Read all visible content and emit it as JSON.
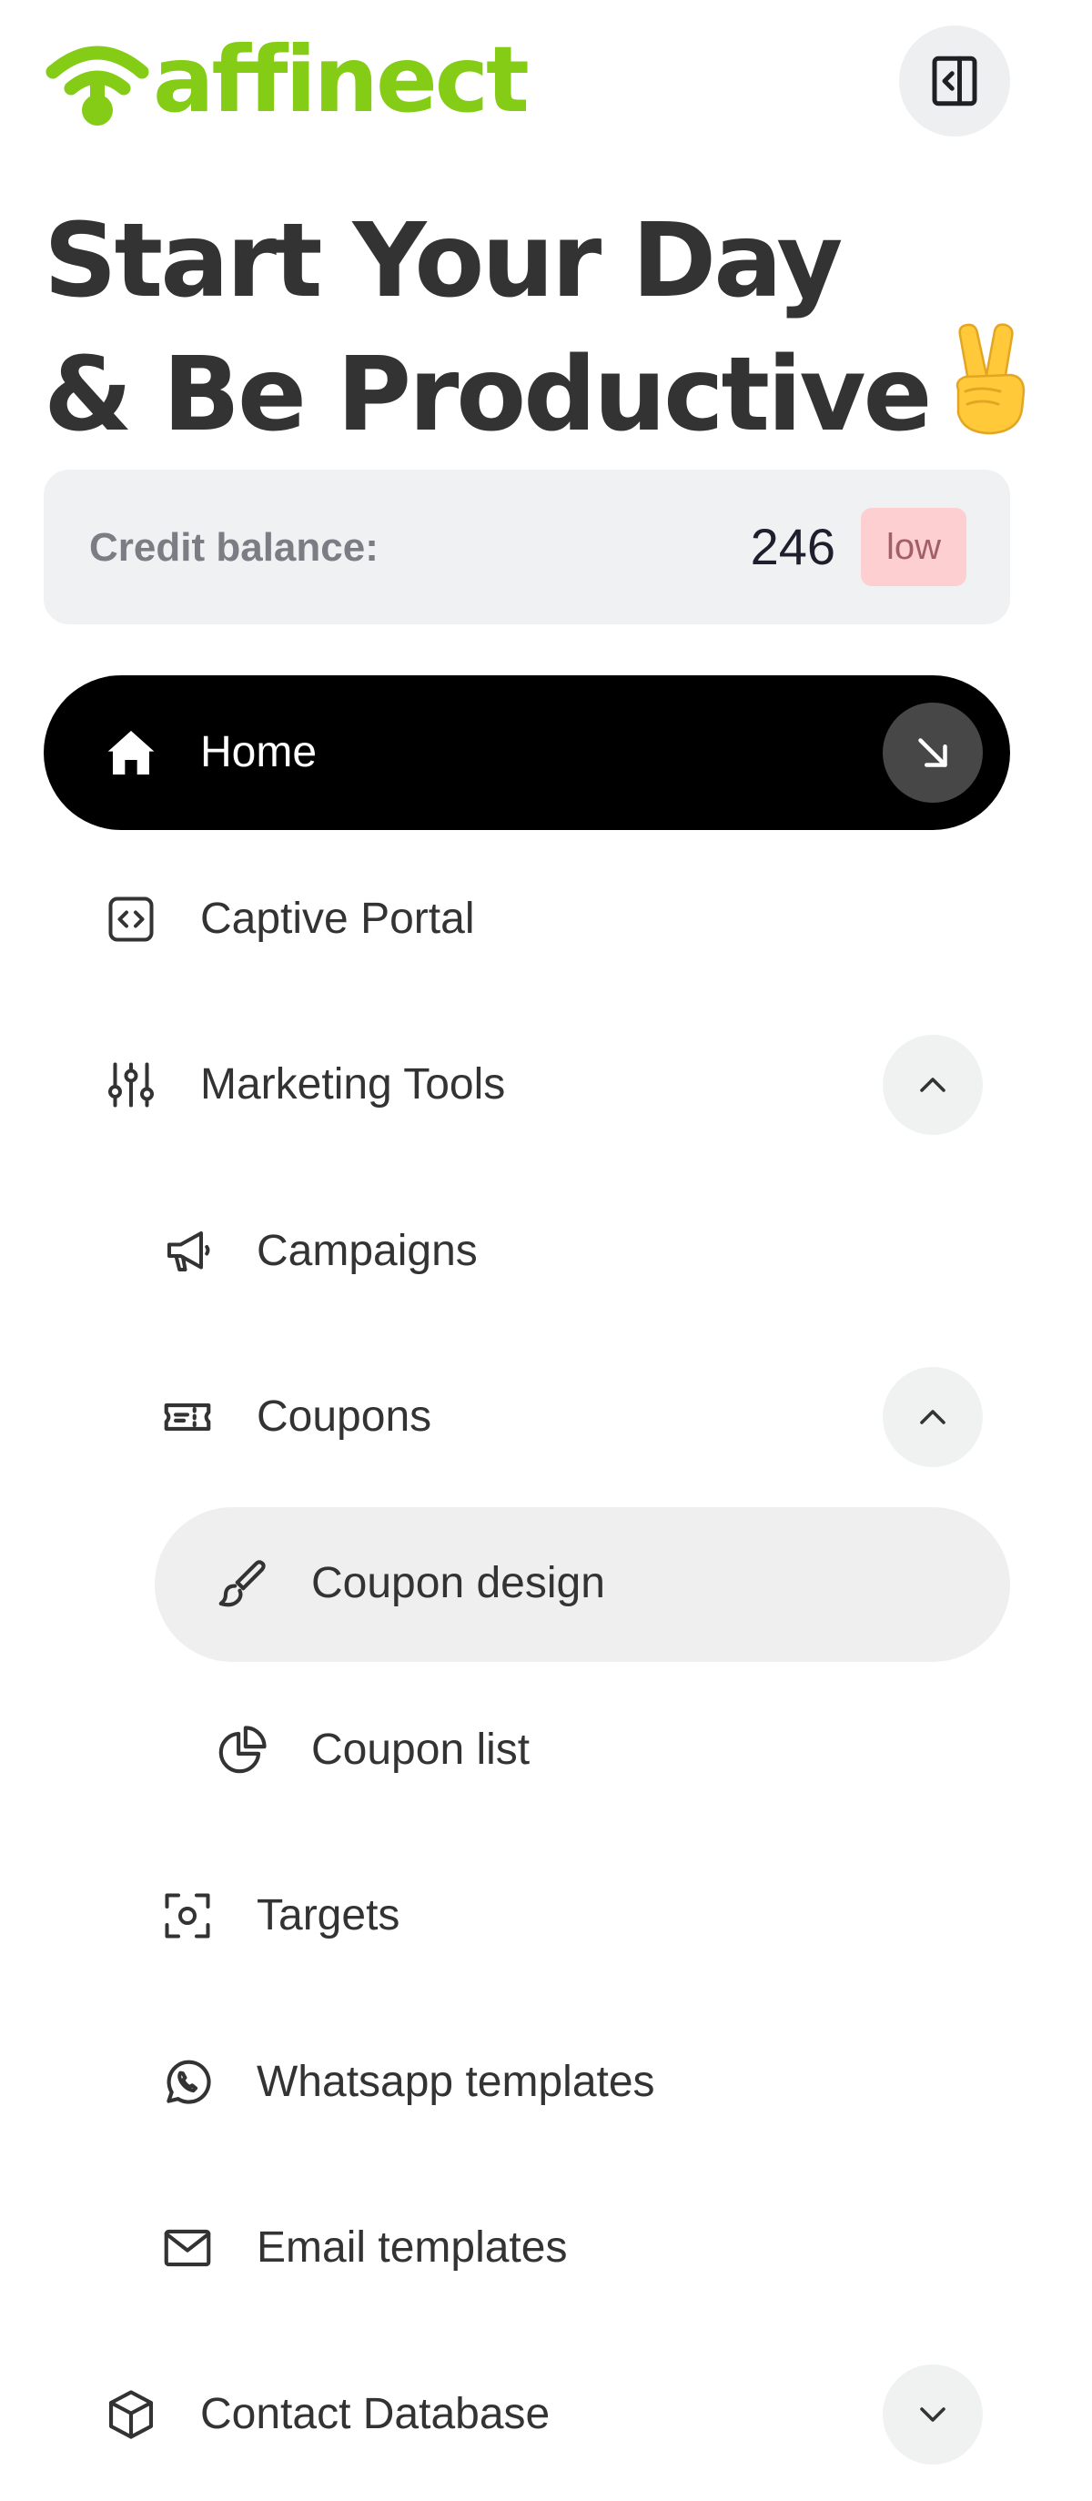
{
  "brand": {
    "name": "affinect",
    "color": "#84cc16"
  },
  "heading": {
    "line1": "Start Your Day",
    "line2": "& Be Productive"
  },
  "credit": {
    "label": "Credit balance:",
    "value": "246",
    "badge": "low",
    "badge_color": "#fdcfd1"
  },
  "nav": {
    "home": "Home",
    "captive_portal": "Captive Portal",
    "marketing_tools": "Marketing Tools",
    "campaigns": "Campaigns",
    "coupons": "Coupons",
    "coupon_design": "Coupon design",
    "coupon_list": "Coupon list",
    "targets": "Targets",
    "whatsapp_templates": "Whatsapp templates",
    "email_templates": "Email templates",
    "contact_database": "Contact Database"
  },
  "icons": {
    "logo": "wifi-logo-icon",
    "collapse": "sidebar-collapse-icon",
    "heading_emoji": "victory-hand-icon",
    "home": "home-icon",
    "home_arrow": "arrow-down-right-icon",
    "captive_portal": "code-box-icon",
    "marketing_tools": "sliders-icon",
    "campaigns": "megaphone-icon",
    "coupons": "ticket-icon",
    "coupon_design": "brush-icon",
    "coupon_list": "pie-chart-icon",
    "targets": "focus-target-icon",
    "whatsapp": "whatsapp-icon",
    "email": "mail-icon",
    "contact_database": "cube-icon"
  }
}
